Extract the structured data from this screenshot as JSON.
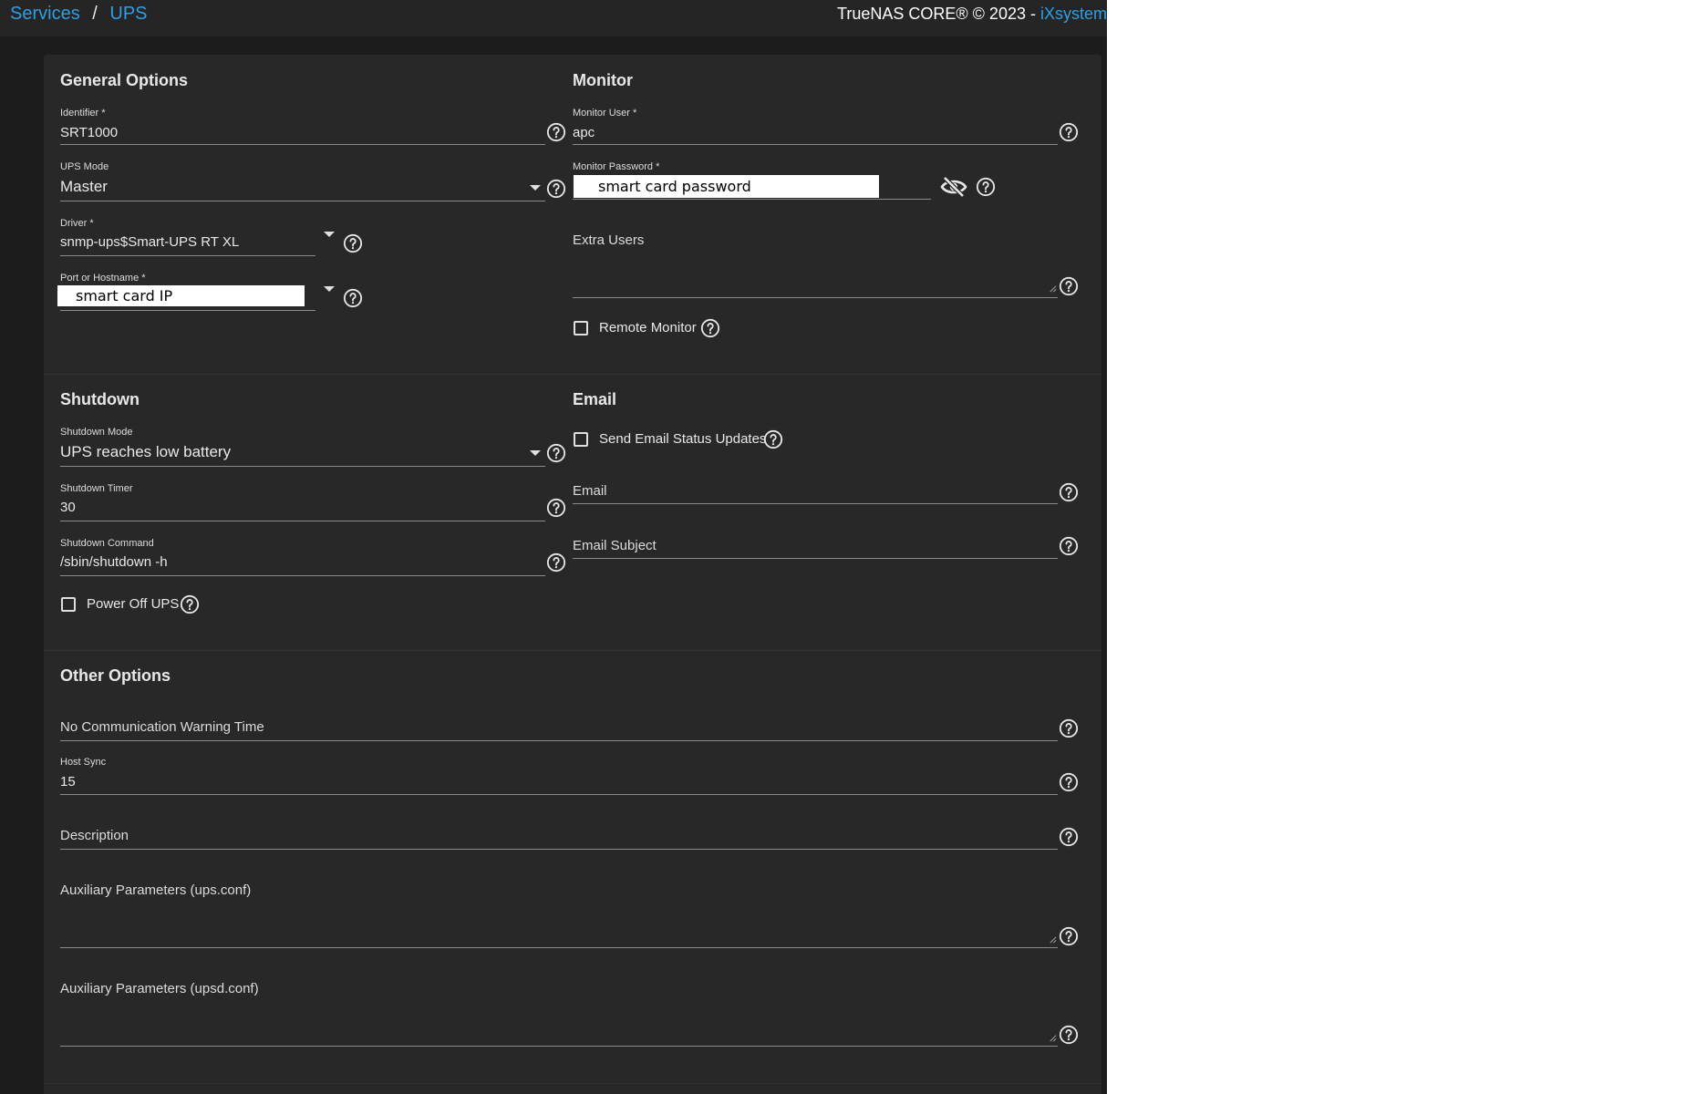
{
  "breadcrumb": {
    "services": "Services",
    "separator": "/",
    "current": "UPS"
  },
  "copyright": {
    "text": "TrueNAS CORE® © 2023 - ",
    "vendor": "iXsystem"
  },
  "general": {
    "title": "General Options",
    "identifier": {
      "label": "Identifier *",
      "value": "SRT1000"
    },
    "ups_mode": {
      "label": "UPS Mode",
      "value": "Master"
    },
    "driver": {
      "label": "Driver *",
      "value": "snmp-ups$Smart-UPS RT XL"
    },
    "port": {
      "label": "Port or Hostname *",
      "value": "smart card IP"
    }
  },
  "monitor": {
    "title": "Monitor",
    "user": {
      "label": "Monitor User *",
      "value": "apc"
    },
    "password": {
      "label": "Monitor Password *",
      "value": "smart card password"
    },
    "extra_users": {
      "placeholder": "Extra Users"
    },
    "remote_monitor": {
      "label": "Remote Monitor",
      "checked": false
    }
  },
  "shutdown": {
    "title": "Shutdown",
    "mode": {
      "label": "Shutdown Mode",
      "value": "UPS reaches low battery"
    },
    "timer": {
      "label": "Shutdown Timer",
      "value": "30"
    },
    "command": {
      "label": "Shutdown Command",
      "value": "/sbin/shutdown -h"
    },
    "power_off": {
      "label": "Power Off UPS",
      "checked": false
    }
  },
  "email": {
    "title": "Email",
    "send_updates": {
      "label": "Send Email Status Updates",
      "checked": false
    },
    "email": {
      "placeholder": "Email"
    },
    "subject": {
      "placeholder": "Email Subject"
    }
  },
  "other": {
    "title": "Other Options",
    "no_comm": {
      "placeholder": "No Communication Warning Time"
    },
    "host_sync": {
      "label": "Host Sync",
      "value": "15"
    },
    "description": {
      "placeholder": "Description"
    },
    "aux_ups": {
      "placeholder": "Auxiliary Parameters (ups.conf)"
    },
    "aux_upsd": {
      "placeholder": "Auxiliary Parameters (upsd.conf)"
    }
  },
  "icons": {
    "help": "help-circle-icon",
    "eye": "visibility-off-icon",
    "dropdown": "caret-down-icon",
    "resize": "resize-handle-icon"
  },
  "colors": {
    "accent": "#2e9fe6",
    "background": "#1c1c1c",
    "panel": "#282828",
    "toolbar": "#252525"
  }
}
